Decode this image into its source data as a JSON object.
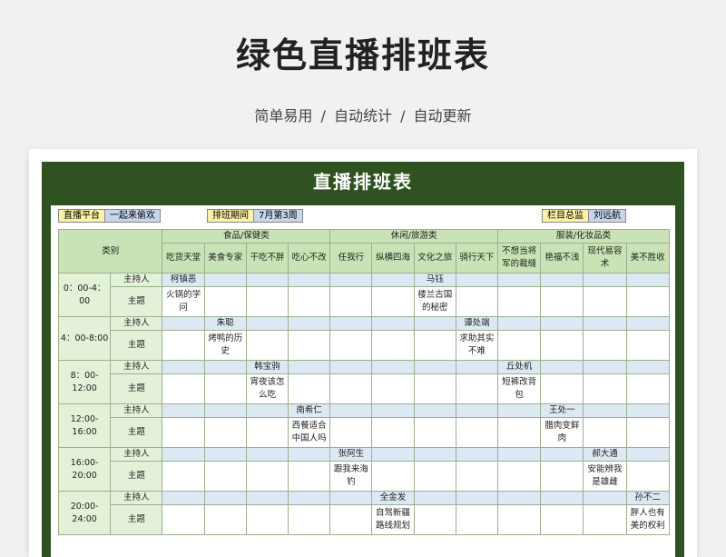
{
  "page": {
    "title": "绿色直播排班表",
    "subtitle": "简单易用 / 自动统计 / 自动更新"
  },
  "sheet": {
    "title": "直播排班表",
    "info": {
      "platform_label": "直播平台",
      "platform_value": "一起来偷欢",
      "period_label": "排班期间",
      "period_value": "7月第3周",
      "supervisor_label": "栏目总监",
      "supervisor_value": "刘远航"
    },
    "header": {
      "category_label": "类别",
      "groups": [
        "食品/保健类",
        "休闲/旅游类",
        "服装/化妆品类"
      ],
      "columns": [
        "吃货天堂",
        "美食专家",
        "干吃不胖",
        "吃心不改",
        "任我行",
        "纵横四海",
        "文化之旅",
        "骑行天下",
        "不想当将军的裁缝",
        "艳福不浅",
        "现代易容术",
        "美不胜收"
      ]
    },
    "row_labels": {
      "host": "主持人",
      "topic": "主题"
    },
    "slots": [
      {
        "time": "0：00-4：00",
        "hosts": [
          "柯镇恶",
          "",
          "",
          "",
          "",
          "",
          "马钰",
          "",
          "",
          "",
          "",
          ""
        ],
        "topics": [
          "火锅的学问",
          "",
          "",
          "",
          "",
          "",
          "楼兰古国的秘密",
          "",
          "",
          "",
          "",
          ""
        ]
      },
      {
        "time": "4：00-8:00",
        "hosts": [
          "",
          "朱聪",
          "",
          "",
          "",
          "",
          "",
          "谭处端",
          "",
          "",
          "",
          ""
        ],
        "topics": [
          "",
          "烤鸭的历史",
          "",
          "",
          "",
          "",
          "",
          "求助其实不难",
          "",
          "",
          "",
          ""
        ]
      },
      {
        "time": "8：00-12:00",
        "hosts": [
          "",
          "",
          "韩宝驹",
          "",
          "",
          "",
          "",
          "",
          "丘处机",
          "",
          "",
          ""
        ],
        "topics": [
          "",
          "",
          "宵夜该怎么吃",
          "",
          "",
          "",
          "",
          "",
          "短裤改背包",
          "",
          "",
          ""
        ]
      },
      {
        "time": "12:00-16:00",
        "hosts": [
          "",
          "",
          "",
          "南希仁",
          "",
          "",
          "",
          "",
          "",
          "王处一",
          "",
          ""
        ],
        "topics": [
          "",
          "",
          "",
          "西餐适合中国人吗",
          "",
          "",
          "",
          "",
          "",
          "腊肉变鲜肉",
          "",
          ""
        ]
      },
      {
        "time": "16:00-20:00",
        "hosts": [
          "",
          "",
          "",
          "",
          "张阿生",
          "",
          "",
          "",
          "",
          "",
          "郝大通",
          ""
        ],
        "topics": [
          "",
          "",
          "",
          "",
          "跟我来海钓",
          "",
          "",
          "",
          "",
          "",
          "安能辨我是雄雌",
          ""
        ]
      },
      {
        "time": "20:00-24:00",
        "hosts": [
          "",
          "",
          "",
          "",
          "",
          "全金发",
          "",
          "",
          "",
          "",
          "",
          "孙不二"
        ],
        "topics": [
          "",
          "",
          "",
          "",
          "",
          "自驾新疆路线规划",
          "",
          "",
          "",
          "",
          "",
          "胖人也有美的权利"
        ]
      }
    ]
  }
}
